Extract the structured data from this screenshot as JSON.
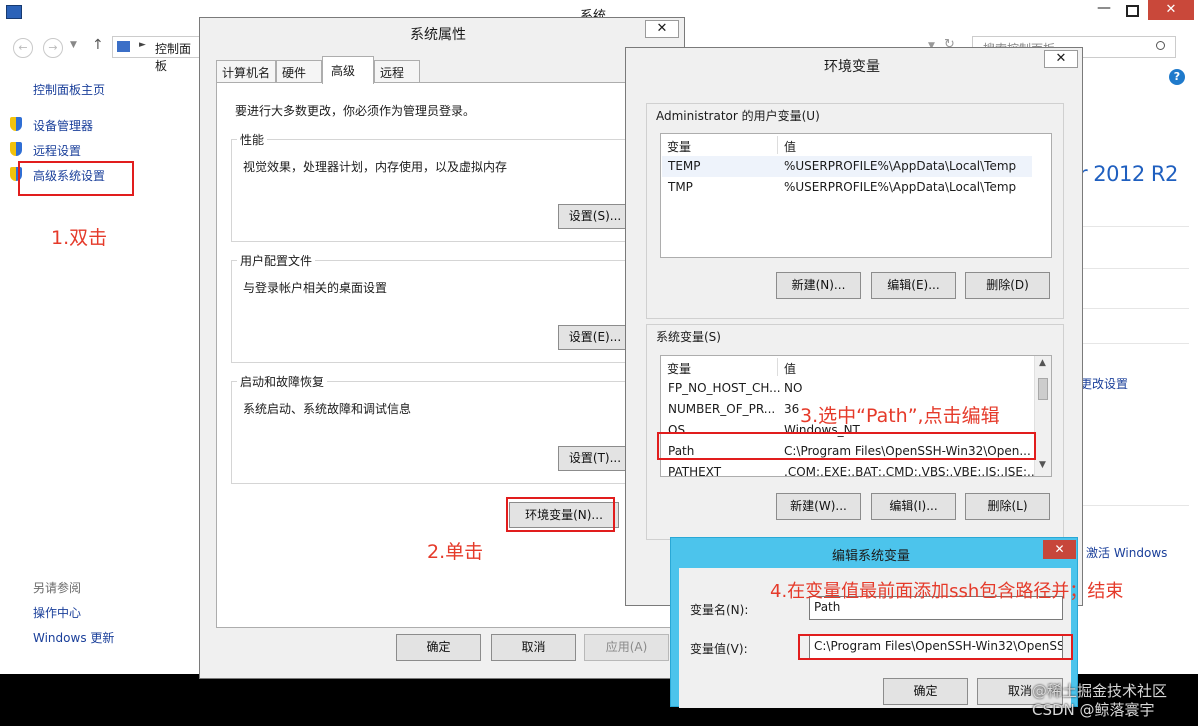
{
  "cp_window": {
    "title": "系统",
    "address_text": "控制面板",
    "search_placeholder": "搜索控制面板",
    "sidebar": {
      "home": "控制面板主页",
      "items": [
        "设备管理器",
        "远程设置",
        "高级系统设置"
      ],
      "see_also_title": "另请参阅",
      "see_also": [
        "操作中心",
        "Windows 更新"
      ]
    },
    "right_text": {
      "brand": "r 2012 R2",
      "change_settings": "更改设置",
      "activate": "激活 Windows"
    }
  },
  "sysprops": {
    "title": "系统属性",
    "tabs": [
      "计算机名",
      "硬件",
      "高级",
      "远程"
    ],
    "active_tab": "高级",
    "admin_note": "要进行大多数更改，你必须作为管理员登录。",
    "groups": [
      {
        "title": "性能",
        "desc": "视觉效果，处理器计划，内存使用，以及虚拟内存",
        "button": "设置(S)..."
      },
      {
        "title": "用户配置文件",
        "desc": "与登录帐户相关的桌面设置",
        "button": "设置(E)..."
      },
      {
        "title": "启动和故障恢复",
        "desc": "系统启动、系统故障和调试信息",
        "button": "设置(T)..."
      }
    ],
    "env_button": "环境变量(N)...",
    "ok": "确定",
    "cancel": "取消",
    "apply": "应用(A)"
  },
  "envvars": {
    "title": "环境变量",
    "user_section": "Administrator 的用户变量(U)",
    "col_var": "变量",
    "col_val": "值",
    "user_rows": [
      {
        "name": "TEMP",
        "value": "%USERPROFILE%\\AppData\\Local\\Temp"
      },
      {
        "name": "TMP",
        "value": "%USERPROFILE%\\AppData\\Local\\Temp"
      }
    ],
    "user_buttons": {
      "new": "新建(N)...",
      "edit": "编辑(E)...",
      "delete": "删除(D)"
    },
    "sys_section": "系统变量(S)",
    "sys_rows": [
      {
        "name": "FP_NO_HOST_CH...",
        "value": "NO"
      },
      {
        "name": "NUMBER_OF_PR...",
        "value": "36"
      },
      {
        "name": "OS",
        "value": "Windows_NT"
      },
      {
        "name": "Path",
        "value": "C:\\Program Files\\OpenSSH-Win32\\Open..."
      },
      {
        "name": "PATHEXT",
        "value": ".COM;.EXE;.BAT;.CMD;.VBS;.VBE;.JS;.JSE;..."
      }
    ],
    "sys_buttons": {
      "new": "新建(W)...",
      "edit": "编辑(I)...",
      "delete": "删除(L)"
    }
  },
  "editvar": {
    "title": "编辑系统变量",
    "name_label": "变量名(N):",
    "name_value": "Path",
    "value_label": "变量值(V):",
    "value_value": "C:\\Program Files\\OpenSSH-Win32\\OpenSS",
    "ok": "确定",
    "cancel": "取消"
  },
  "annotations": {
    "step1": "1.双击",
    "step2": "2.单击",
    "step3": "3.选中“Path”,点击编辑",
    "step4": "4.在变量值最前面添加ssh包含路径并；结束"
  },
  "watermark": "@稀土掘金技术社区\nCSDN @鲸落寰宇",
  "colors": {
    "annotation_red": "#e11d1d",
    "dialog_title_blue": "#4cc4ec",
    "link_blue": "#1a5fb4"
  }
}
